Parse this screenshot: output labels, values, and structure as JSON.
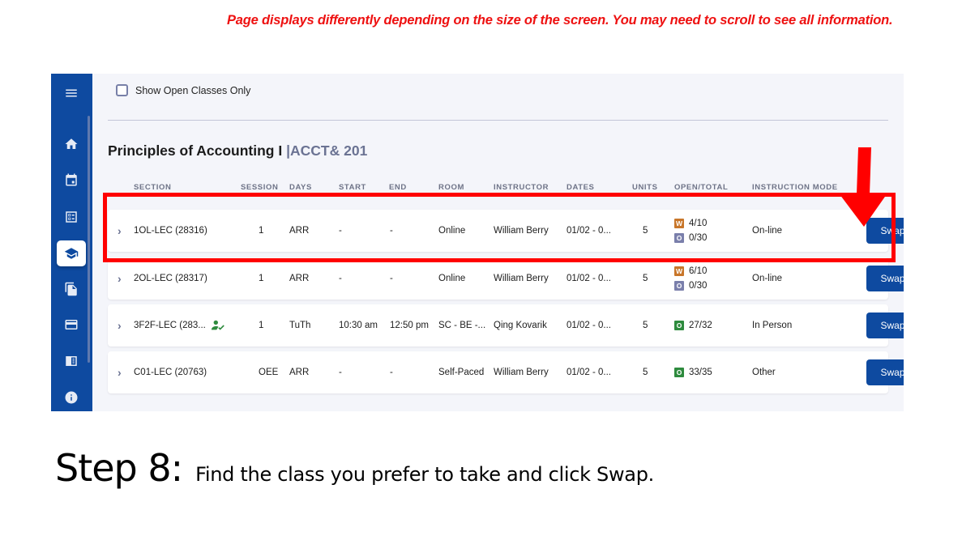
{
  "notice": "Page displays differently depending on the size of the screen. You may need to scroll to see all information.",
  "sidebar": {
    "items": [
      {
        "icon": "menu-icon"
      },
      {
        "icon": "home-icon"
      },
      {
        "icon": "calendar-icon"
      },
      {
        "icon": "checklist-icon"
      },
      {
        "icon": "graduation-cap-icon",
        "active": true
      },
      {
        "icon": "documents-icon"
      },
      {
        "icon": "credit-card-icon"
      },
      {
        "icon": "catalog-icon"
      },
      {
        "icon": "info-icon"
      }
    ]
  },
  "filter": {
    "label": "Show Open Classes Only",
    "checked": false
  },
  "course": {
    "title": "Principles of Accounting I",
    "separator": "|",
    "code": "ACCT& 201"
  },
  "table": {
    "headers": {
      "section": "SECTION",
      "session": "SESSION",
      "days": "DAYS",
      "start": "START",
      "end": "END",
      "room": "ROOM",
      "instructor": "INSTRUCTOR",
      "dates": "DATES",
      "units": "UNITS",
      "open_total": "OPEN/TOTAL",
      "mode": "INSTRUCTION MODE"
    },
    "rows": [
      {
        "section": "1OL-LEC (28316)",
        "session": "1",
        "days": "ARR",
        "start": "-",
        "end": "-",
        "room": "Online",
        "instructor": "William Berry",
        "dates": "01/02 - 0...",
        "units": "5",
        "seats": [
          {
            "badge": "W",
            "value": "4/10",
            "color": "#c8762a"
          },
          {
            "badge": "O",
            "value": "0/30",
            "color": "#7a7fab"
          }
        ],
        "mode": "On-line",
        "swap": "Swap"
      },
      {
        "section": "2OL-LEC (28317)",
        "session": "1",
        "days": "ARR",
        "start": "-",
        "end": "-",
        "room": "Online",
        "instructor": "William Berry",
        "dates": "01/02 - 0...",
        "units": "5",
        "seats": [
          {
            "badge": "W",
            "value": "6/10",
            "color": "#c8762a"
          },
          {
            "badge": "O",
            "value": "0/30",
            "color": "#7a7fab"
          }
        ],
        "mode": "On-line",
        "swap": "Swap"
      },
      {
        "section": "3F2F-LEC (283...",
        "session": "1",
        "days": "TuTh",
        "start": "10:30 am",
        "end": "12:50 pm",
        "room": "SC - BE -...",
        "instructor": "Qing Kovarik",
        "dates": "01/02 - 0...",
        "units": "5",
        "seats": [
          {
            "badge": "O",
            "value": "27/32",
            "color": "#2e8b3e"
          }
        ],
        "mode": "In Person",
        "swap": "Swap",
        "status_icon": "person-check-icon"
      },
      {
        "section": "C01-LEC (20763)",
        "session": "OEE",
        "days": "ARR",
        "start": "-",
        "end": "-",
        "room": "Self-Paced",
        "instructor": "William Berry",
        "dates": "01/02 - 0...",
        "units": "5",
        "seats": [
          {
            "badge": "O",
            "value": "33/35",
            "color": "#2e8b3e"
          }
        ],
        "mode": "Other",
        "swap": "Swap"
      }
    ]
  },
  "colors": {
    "brand": "#0e4aa0",
    "highlight": "#ff0000",
    "background": "#f4f5fa"
  },
  "step": {
    "number": "Step 8:",
    "text_prefix": "Find the class you prefer to take and click ",
    "text_emphasis": "Swap",
    "text_suffix": "."
  }
}
